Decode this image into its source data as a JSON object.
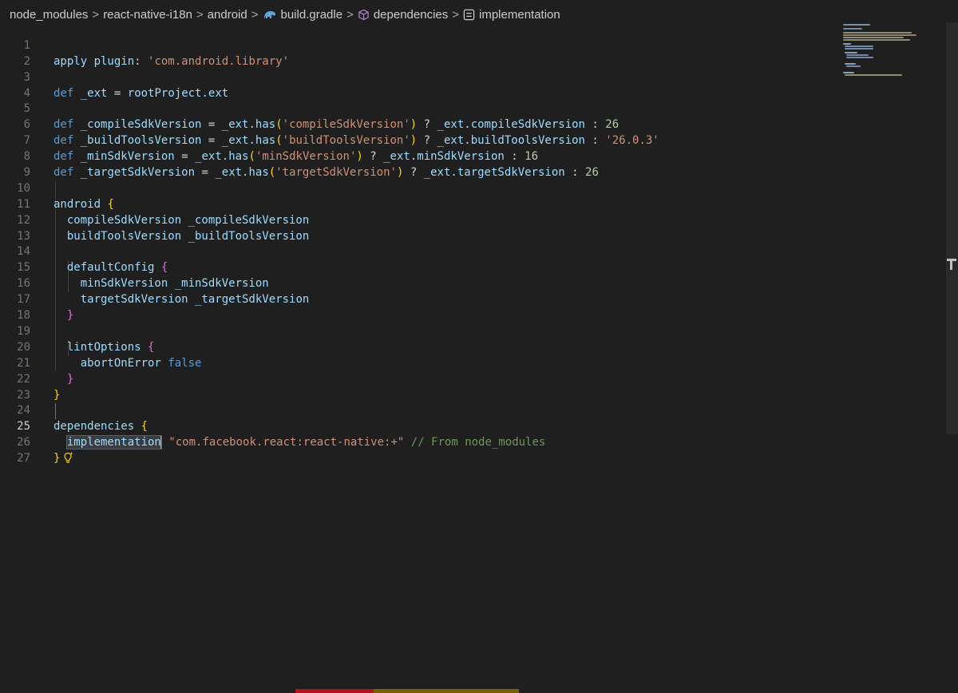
{
  "breadcrumb": {
    "items": [
      {
        "label": "node_modules",
        "icon": ""
      },
      {
        "label": "react-native-i18n",
        "icon": ""
      },
      {
        "label": "android",
        "icon": ""
      },
      {
        "label": "build.gradle",
        "icon": "gradle-elephant-icon"
      },
      {
        "label": "dependencies",
        "icon": "cube-icon"
      },
      {
        "label": "implementation",
        "icon": "symbol-field-icon"
      }
    ],
    "separator": ">"
  },
  "editor": {
    "active_line": "25",
    "line_numbers": [
      "1",
      "2",
      "3",
      "4",
      "5",
      "6",
      "7",
      "8",
      "9",
      "10",
      "11",
      "12",
      "13",
      "14",
      "15",
      "16",
      "17",
      "18",
      "19",
      "20",
      "21",
      "22",
      "23",
      "24",
      "25",
      "26",
      "27"
    ],
    "lines": [
      "apply plugin: 'com.android.library'",
      "",
      "def _ext = rootProject.ext",
      "",
      "def _compileSdkVersion = _ext.has('compileSdkVersion') ? _ext.compileSdkVersion : 26",
      "def _buildToolsVersion = _ext.has('buildToolsVersion') ? _ext.buildToolsVersion : '26.0.3'",
      "def _minSdkVersion = _ext.has('minSdkVersion') ? _ext.minSdkVersion : 16",
      "def _targetSdkVersion = _ext.has('targetSdkVersion') ? _ext.targetSdkVersion : 26",
      "",
      "android {",
      "  compileSdkVersion _compileSdkVersion",
      "  buildToolsVersion _buildToolsVersion",
      "",
      "  defaultConfig {",
      "    minSdkVersion _minSdkVersion",
      "    targetSdkVersion _targetSdkVersion",
      "  }",
      "",
      "  lintOptions {",
      "    abortOnError false",
      "  }",
      "}",
      "",
      "dependencies {",
      "  implementation \"com.facebook.react:react-native:+\" // From node_modules",
      "}",
      ""
    ]
  },
  "colors": {
    "background": "#1f1f1f",
    "keyword": "#569cd6",
    "string": "#ce9178",
    "number": "#b5cea8",
    "comment": "#6a9955",
    "bracket_level1": "#ffd700",
    "bracket_level2": "#da70d6"
  }
}
